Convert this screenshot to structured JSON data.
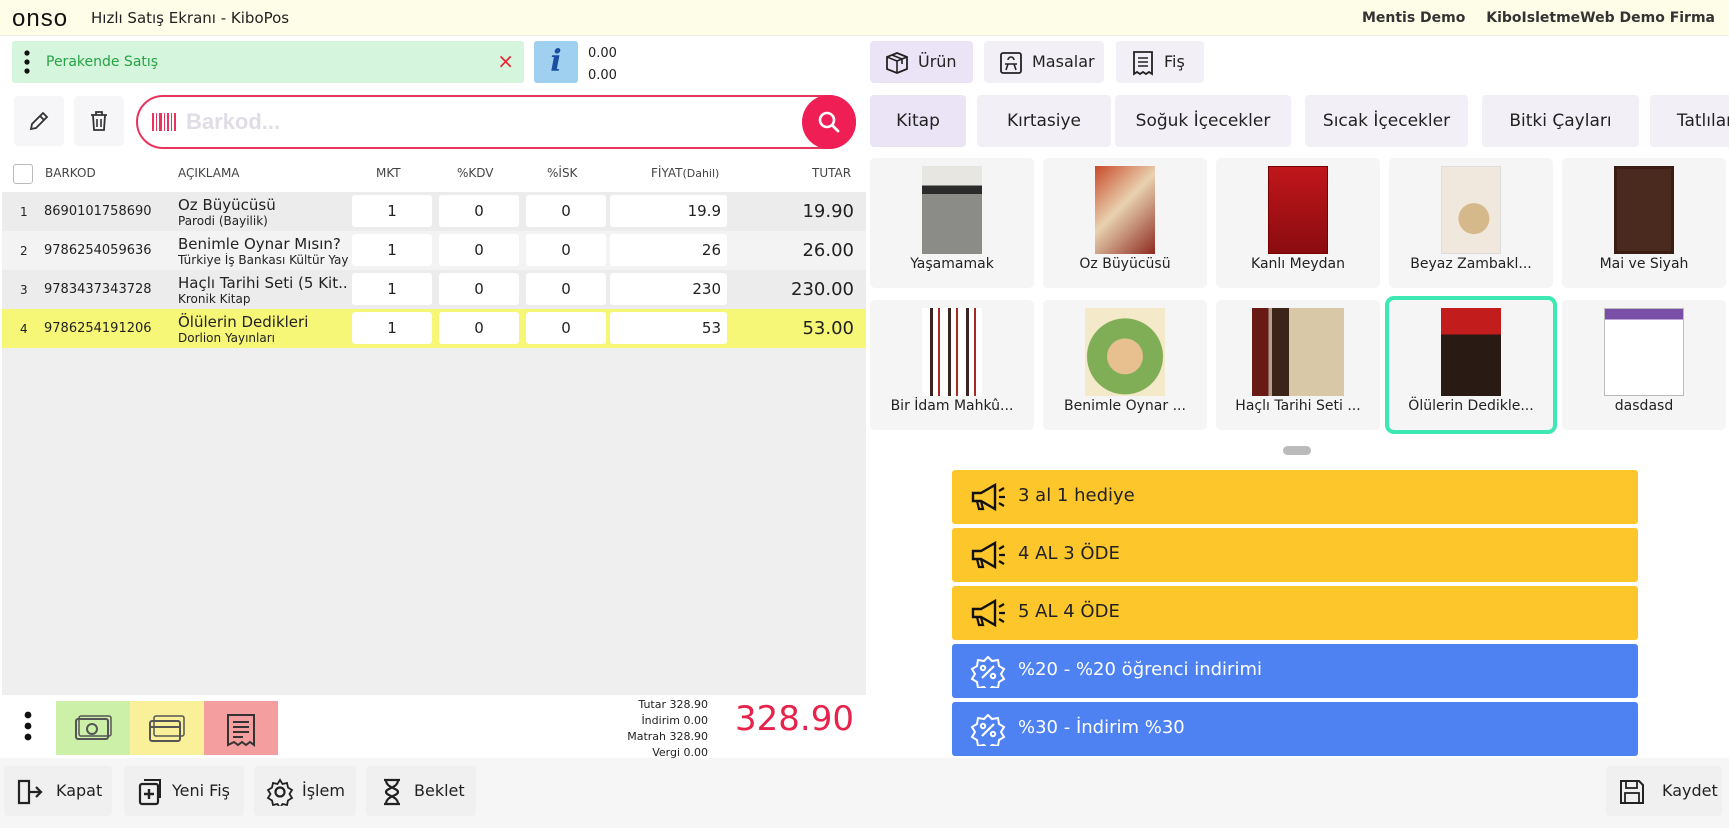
{
  "header": {
    "logo": "onso",
    "title": "Hızlı Satış Ekranı - KiboPos",
    "user": "Mentis Demo",
    "company": "KiboIsletmeWeb Demo Firma"
  },
  "customer": {
    "name": "Perakende Satış",
    "close": "×"
  },
  "info": {
    "icon": "i",
    "value1": "0.00",
    "value2": "0.00"
  },
  "barcode": {
    "placeholder": "Barkod..."
  },
  "table": {
    "headers": {
      "barkod": "BARKOD",
      "aciklama": "AÇIKLAMA",
      "mkt": "MKT",
      "kdv": "%KDV",
      "isk": "%İSK",
      "fiyat": "FİYAT",
      "fiyat_suffix": "(Dahil)",
      "tutar": "TUTAR"
    },
    "rows": [
      {
        "no": "1",
        "barcode": "8690101758690",
        "name": "Oz Büyücüsü",
        "publisher": "Parodi (Bayilik)",
        "qty": "1",
        "kdv": "0",
        "isk": "0",
        "price": "19.9",
        "total": "19.90"
      },
      {
        "no": "2",
        "barcode": "9786254059636",
        "name": "Benimle Oynar Mısın?",
        "publisher": "Türkiye İş Bankası Kültür Yay",
        "qty": "1",
        "kdv": "0",
        "isk": "0",
        "price": "26",
        "total": "26.00"
      },
      {
        "no": "3",
        "barcode": "9783437343728",
        "name": "Haçlı Tarihi Seti (5 Kit...",
        "publisher": "Kronik Kitap",
        "qty": "1",
        "kdv": "0",
        "isk": "0",
        "price": "230",
        "total": "230.00"
      },
      {
        "no": "4",
        "barcode": "9786254191206",
        "name": "Ölülerin Dedikleri",
        "publisher": "Dorlion Yayınları",
        "qty": "1",
        "kdv": "0",
        "isk": "0",
        "price": "53",
        "total": "53.00"
      }
    ]
  },
  "summary": {
    "tutar_label": "Tutar",
    "tutar": "328.90",
    "indirim_label": "İndirim",
    "indirim": "0.00",
    "matrah_label": "Matrah",
    "matrah": "328.90",
    "vergi_label": "Vergi",
    "vergi": "0.00",
    "grand_total": "328.90"
  },
  "footer": {
    "kapat": "Kapat",
    "yeni_fis": "Yeni Fiş",
    "islem": "İşlem",
    "beklet": "Beklet",
    "kaydet": "Kaydet"
  },
  "tabs": {
    "urun": "Ürün",
    "masalar": "Masalar",
    "fis": "Fiş"
  },
  "categories": [
    "Kitap",
    "Kırtasiye",
    "Soğuk İçecekler",
    "Sıcak İçecekler",
    "Bitki Çayları",
    "Tatlılar"
  ],
  "products": [
    {
      "title": "Yaşamamak"
    },
    {
      "title": "Oz Büyücüsü"
    },
    {
      "title": "Kanlı Meydan"
    },
    {
      "title": "Beyaz Zambakl..."
    },
    {
      "title": "Mai ve Siyah"
    },
    {
      "title": "Bir İdam Mahkû..."
    },
    {
      "title": "Benimle Oynar ..."
    },
    {
      "title": "Haçlı Tarihi Seti ..."
    },
    {
      "title": "Ölülerin Dedikle..."
    },
    {
      "title": "dasdasd"
    }
  ],
  "promotions": [
    {
      "label": "3 al 1 hediye",
      "color": "#fdc72c"
    },
    {
      "label": "4 AL 3 ÖDE",
      "color": "#fdc72c"
    },
    {
      "label": "5 AL 4 ÖDE",
      "color": "#fdc72c"
    },
    {
      "label": "%20 - %20 öğrenci indirimi",
      "color": "#4e82f3"
    },
    {
      "label": "%30 - İndirim %30",
      "color": "#4e82f3"
    }
  ],
  "colors": {
    "accent": "#ef1f55",
    "selected_row": "#f6f776",
    "customer_bg": "#d5f5dc",
    "grand_total": "#e7224b"
  }
}
